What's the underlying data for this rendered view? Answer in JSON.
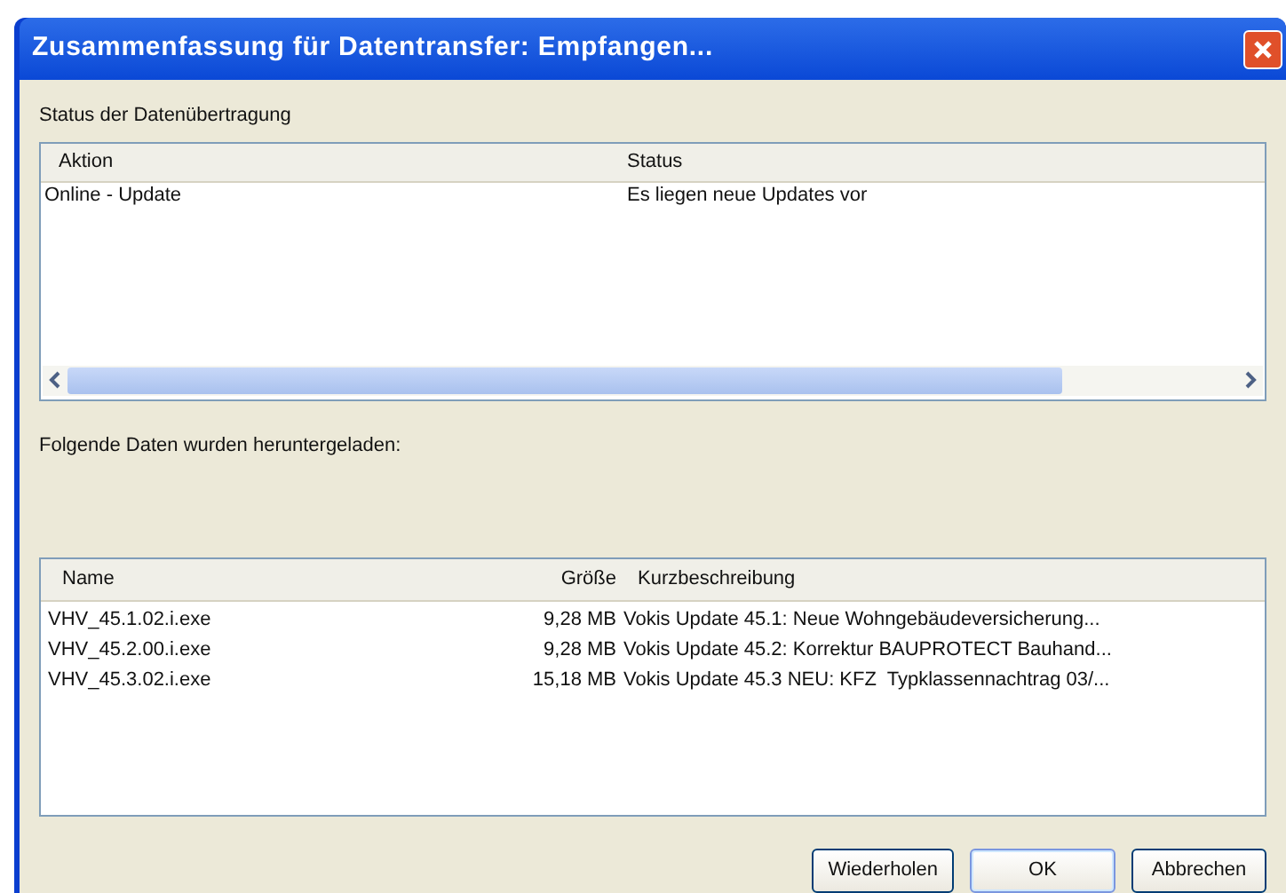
{
  "window": {
    "title": "Zusammenfassung für Datentransfer: Empfangen..."
  },
  "status_section": {
    "label": "Status der Datenübertragung",
    "columns": [
      "Aktion",
      "Status"
    ],
    "rows": [
      {
        "action": "Online - Update",
        "status": "Es liegen neue Updates vor"
      }
    ]
  },
  "download_section": {
    "label": "Folgende Daten wurden heruntergeladen:",
    "columns": [
      "Name",
      "Größe",
      "Kurzbeschreibung"
    ],
    "rows": [
      {
        "name": "VHV_45.1.02.i.exe",
        "size": "9,28 MB",
        "description": "Vokis Update 45.1: Neue Wohngebäudeversicherung..."
      },
      {
        "name": "VHV_45.2.00.i.exe",
        "size": "9,28 MB",
        "description": "Vokis Update 45.2: Korrektur BAUPROTECT Bauhand..."
      },
      {
        "name": "VHV_45.3.02.i.exe",
        "size": "15,18 MB",
        "description": "Vokis Update 45.3 NEU: KFZ  Typklassennachtrag 03/..."
      }
    ]
  },
  "buttons": [
    {
      "label": "Wiederholen",
      "selected": false
    },
    {
      "label": "OK",
      "selected": true
    },
    {
      "label": "Abbrechen",
      "selected": false
    }
  ]
}
